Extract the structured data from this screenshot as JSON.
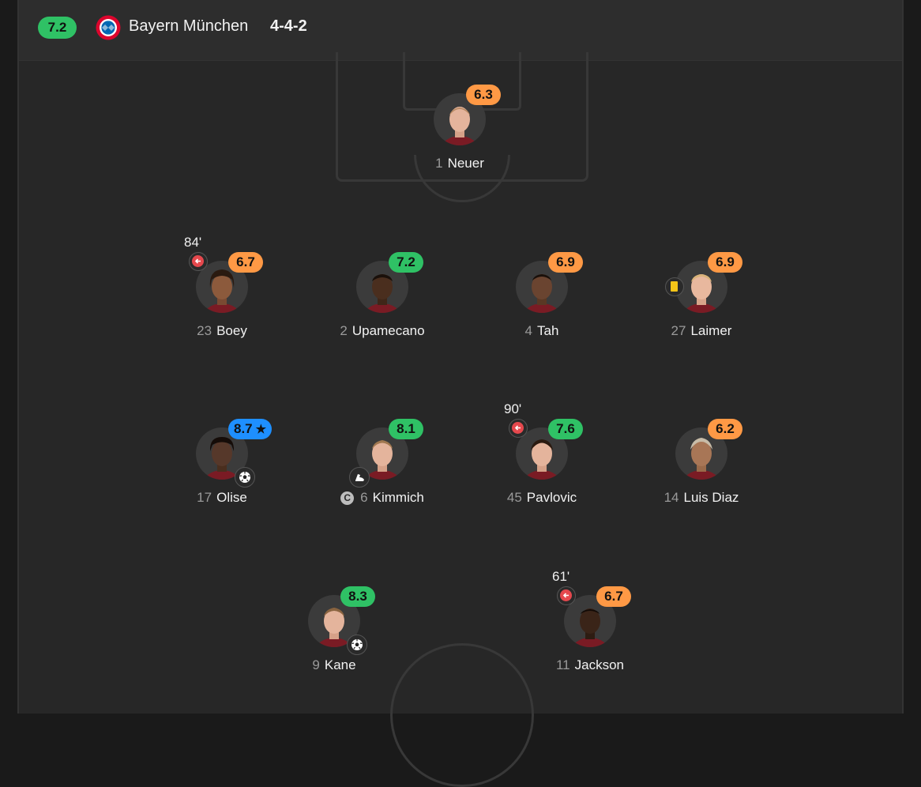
{
  "header": {
    "team_rating": "7.2",
    "team_name": "Bayern München",
    "formation": "4-4-2"
  },
  "colors": {
    "rating_green": "#2fc165",
    "rating_orange": "#ff9945",
    "rating_blue": "#1e8fff",
    "sub_red": "#e5484d",
    "yellow_card": "#f5c518"
  },
  "players": [
    {
      "number": "1",
      "name": "Neuer",
      "rating": "6.3",
      "rating_color": "orange"
    },
    {
      "number": "23",
      "name": "Boey",
      "rating": "6.7",
      "rating_color": "orange",
      "sub_time": "84'",
      "subbed_off": true
    },
    {
      "number": "2",
      "name": "Upamecano",
      "rating": "7.2",
      "rating_color": "green"
    },
    {
      "number": "4",
      "name": "Tah",
      "rating": "6.9",
      "rating_color": "orange"
    },
    {
      "number": "27",
      "name": "Laimer",
      "rating": "6.9",
      "rating_color": "orange",
      "yellow_card": true
    },
    {
      "number": "17",
      "name": "Olise",
      "rating": "8.7",
      "rating_color": "blue",
      "player_of_match": true,
      "goal": true
    },
    {
      "number": "6",
      "name": "Kimmich",
      "rating": "8.1",
      "rating_color": "green",
      "captain": true,
      "assist": true
    },
    {
      "number": "45",
      "name": "Pavlovic",
      "rating": "7.6",
      "rating_color": "green",
      "sub_time": "90'",
      "subbed_off": true
    },
    {
      "number": "14",
      "name": "Luis Diaz",
      "rating": "6.2",
      "rating_color": "orange"
    },
    {
      "number": "9",
      "name": "Kane",
      "rating": "8.3",
      "rating_color": "green",
      "goal": true
    },
    {
      "number": "11",
      "name": "Jackson",
      "rating": "6.7",
      "rating_color": "orange",
      "sub_time": "61'",
      "subbed_off": true
    }
  ],
  "icons": {
    "crest": "bayern-crest-icon",
    "sub_off": "substitution-arrow-icon",
    "goal": "football-icon",
    "assist": "boot-icon",
    "captain": "captain-icon",
    "card": "yellow-card-icon",
    "star": "star-icon"
  },
  "captain_label": "C"
}
